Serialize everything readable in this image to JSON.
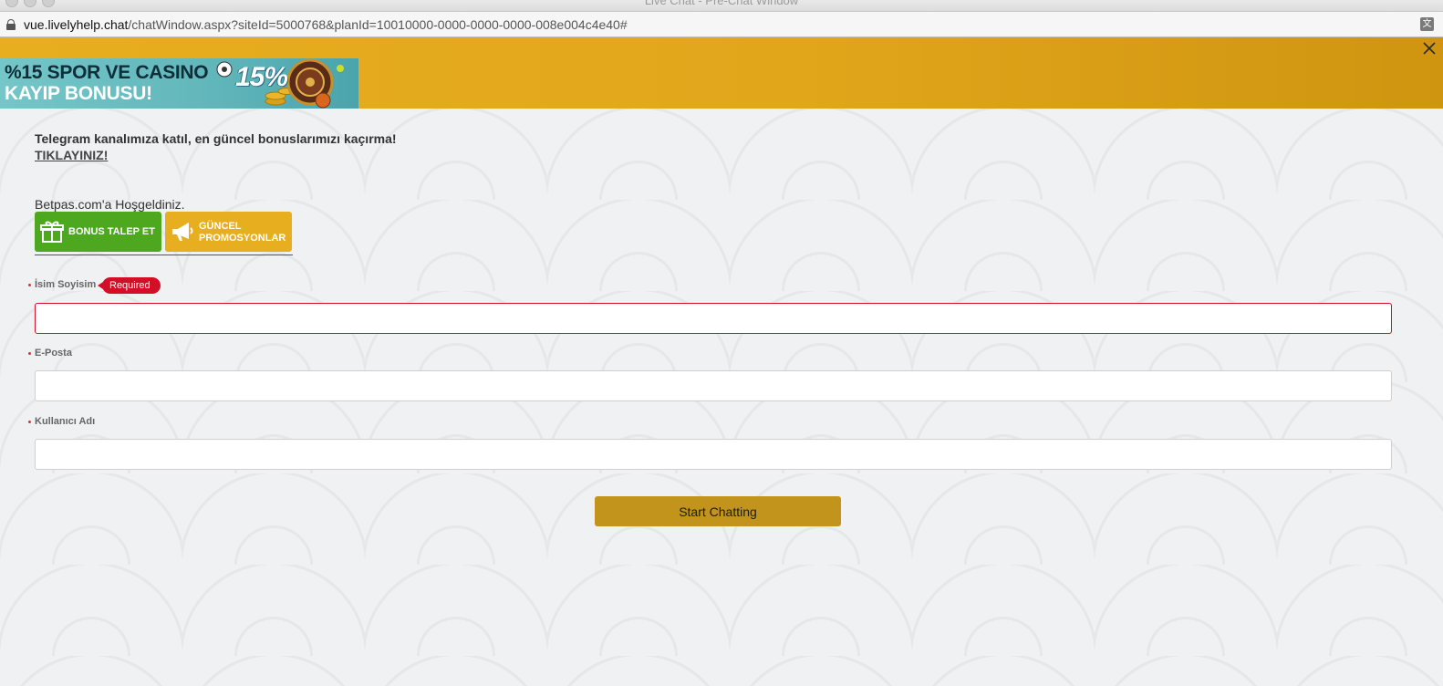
{
  "window": {
    "title": "Live Chat - Pre-Chat Window",
    "url_host": "vue.livelyhelp.chat",
    "url_path": "/chatWindow.aspx?siteId=5000768&planId=10010000-0000-0000-0000-008e004c4e40#"
  },
  "banner": {
    "line1": "%15 SPOR VE CASINO",
    "line2": "KAYIP BONUSU!",
    "badge": "15%"
  },
  "intro": {
    "telegram_text": "Telegram kanalımıza katıl, en güncel bonuslarımızı kaçırma!",
    "telegram_link": "TIKLAYINIZ!",
    "welcome": "Betpas.com'a Hoşgeldiniz."
  },
  "buttons": {
    "bonus_label": "BONUS TALEP ET",
    "promo_line1": "GÜNCEL",
    "promo_line2": "PROMOSYONLAR"
  },
  "form": {
    "fields": [
      {
        "label": "İsim Soyisim",
        "value": "",
        "required": true,
        "error": "Required"
      },
      {
        "label": "E-Posta",
        "value": "",
        "required": true
      },
      {
        "label": "Kullanıcı Adı",
        "value": "",
        "required": true
      }
    ],
    "submit_label": "Start Chatting"
  },
  "colors": {
    "header_gold": "#e2a61b",
    "bonus_green": "#4da81f",
    "promo_gold": "#e7ae1f",
    "error_red": "#d50e27",
    "submit_gold": "#c3941b"
  },
  "icons": {
    "close": "close-icon",
    "gift": "gift-icon",
    "megaphone": "megaphone-icon",
    "lock": "lock-icon",
    "translate": "translate-icon"
  }
}
